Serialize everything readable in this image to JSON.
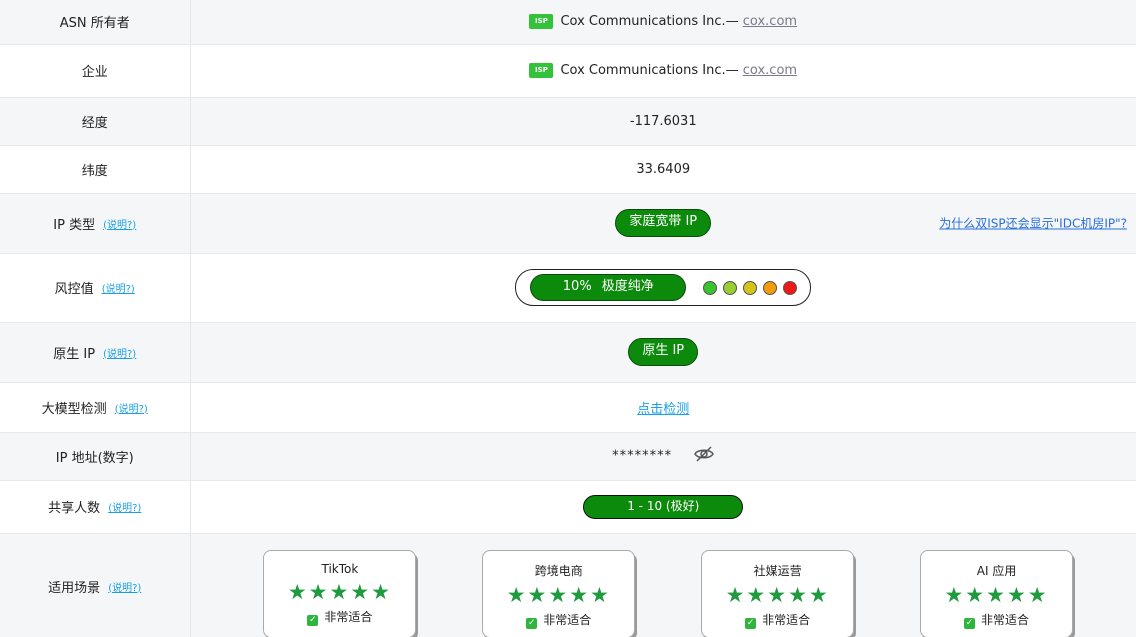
{
  "asn": {
    "label": "ASN 所有者",
    "badge": "ISP",
    "name": "Cox Communications Inc.—",
    "link": "cox.com"
  },
  "company": {
    "label": "企业",
    "badge": "ISP",
    "name": "Cox Communications Inc.—",
    "link": "cox.com"
  },
  "longitude": {
    "label": "经度",
    "value": "-117.6031"
  },
  "latitude": {
    "label": "纬度",
    "value": "33.6409"
  },
  "ip_type": {
    "label": "IP 类型",
    "note": "(说明?)",
    "value": "家庭宽带 IP",
    "why_link": "为什么双ISP还会显示\"IDC机房IP\"?"
  },
  "risk": {
    "label": "风控值",
    "note": "(说明?)",
    "percent": "10%",
    "level_text": "极度纯净",
    "colors": [
      "#39c22f",
      "#9acd32",
      "#d4c41a",
      "#f29b0c",
      "#f01818"
    ]
  },
  "native_ip": {
    "label": "原生 IP",
    "note": "(说明?)",
    "value": "原生 IP"
  },
  "llm_check": {
    "label": "大模型检测",
    "note": "(说明?)",
    "link": "点击检测"
  },
  "ip_numeric": {
    "label": "IP 地址(数字)",
    "masked": "********",
    "eye_icon": "eye-slash-icon"
  },
  "shared_users": {
    "label": "共享人数",
    "note": "(说明?)",
    "value": "1 - 10 (极好)"
  },
  "scenarios": {
    "label": "适用场景",
    "note": "(说明?)",
    "cards": [
      {
        "title": "TikTok",
        "stars": "★★★★★",
        "fit": "非常适合"
      },
      {
        "title": "跨境电商",
        "stars": "★★★★★",
        "fit": "非常适合"
      },
      {
        "title": "社媒运营",
        "stars": "★★★★★",
        "fit": "非常适合"
      },
      {
        "title": "AI 应用",
        "stars": "★★★★★",
        "fit": "非常适合"
      }
    ]
  },
  "accent_green": "#0c8a0c",
  "link_blue": "#1aa0e6"
}
